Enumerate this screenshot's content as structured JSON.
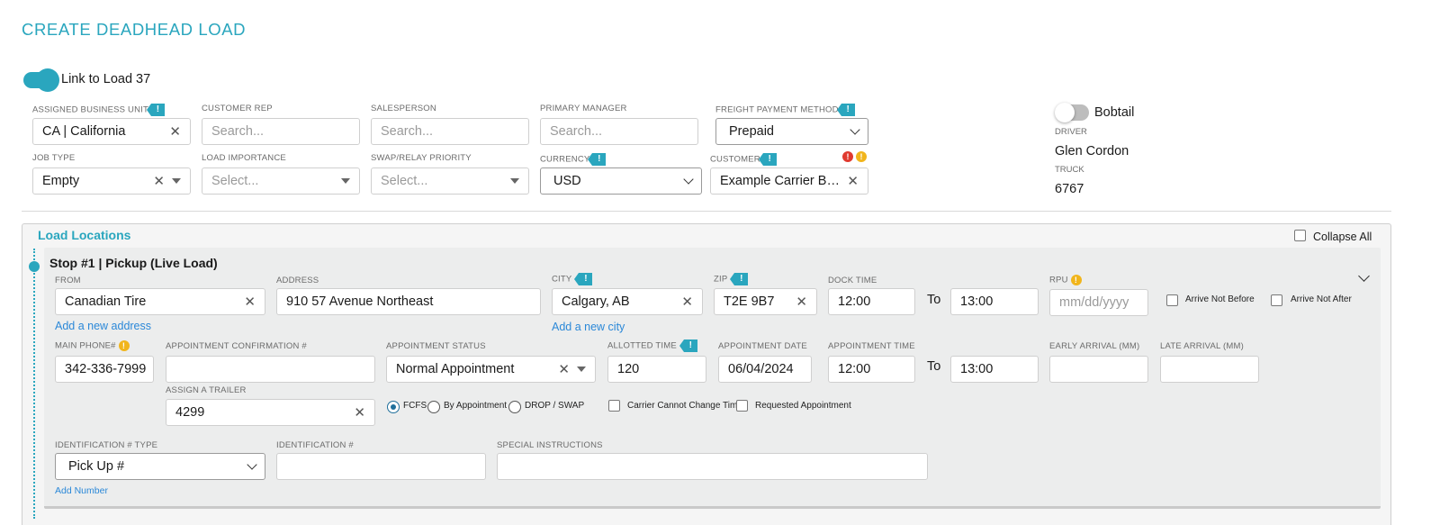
{
  "title": "CREATE DEADHEAD LOAD",
  "link_toggle": {
    "label": "Link to Load 37",
    "on": true
  },
  "header": {
    "business_unit": {
      "label": "ASSIGNED BUSINESS UNIT",
      "value": "CA | California"
    },
    "customer_rep": {
      "label": "CUSTOMER REP",
      "placeholder": "Search..."
    },
    "salesperson": {
      "label": "SALESPERSON",
      "placeholder": "Search..."
    },
    "primary_manager": {
      "label": "PRIMARY MANAGER",
      "placeholder": "Search..."
    },
    "freight_payment": {
      "label": "FREIGHT PAYMENT METHOD",
      "value": "Prepaid"
    },
    "job_type": {
      "label": "JOB TYPE",
      "value": "Empty"
    },
    "load_importance": {
      "label": "LOAD IMPORTANCE",
      "placeholder": "Select..."
    },
    "swap_priority": {
      "label": "SWAP/RELAY PRIORITY",
      "placeholder": "Select..."
    },
    "currency": {
      "label": "CURRENCY",
      "value": "USD"
    },
    "customer": {
      "label": "CUSTOMER",
      "value": "Example Carrier Broke..."
    }
  },
  "side": {
    "bobtail_label": "Bobtail",
    "bobtail_on": false,
    "driver_label": "DRIVER",
    "driver_value": "Glen Cordon",
    "truck_label": "TRUCK",
    "truck_value": "6767"
  },
  "locations": {
    "title": "Load Locations",
    "collapse_all": "Collapse All",
    "stop": {
      "title": "Stop #1 | Pickup (Live Load)",
      "from": {
        "label": "FROM",
        "value": "Canadian Tire"
      },
      "address": {
        "label": "ADDRESS",
        "value": "910 57 Avenue Northeast"
      },
      "city": {
        "label": "CITY",
        "value": "Calgary, AB"
      },
      "zip": {
        "label": "ZIP",
        "value": "T2E 9B7"
      },
      "dock_time": {
        "label": "DOCK TIME",
        "from": "12:00",
        "to": "13:00"
      },
      "to_word": "To",
      "rpu": {
        "label": "RPU",
        "placeholder": "mm/dd/yyyy"
      },
      "arrive_not_before": "Arrive Not Before",
      "arrive_not_after": "Arrive Not After",
      "add_address": "Add a new address",
      "add_city": "Add a new city",
      "main_phone": {
        "label": "MAIN PHONE#",
        "value": "342-336-7999"
      },
      "appt_confirmation": {
        "label": "APPOINTMENT CONFIRMATION #",
        "value": ""
      },
      "appt_status": {
        "label": "APPOINTMENT STATUS",
        "value": "Normal Appointment"
      },
      "allotted_time": {
        "label": "ALLOTTED TIME",
        "value": "120"
      },
      "appt_date": {
        "label": "APPOINTMENT DATE",
        "value": "06/04/2024"
      },
      "appt_time": {
        "label": "APPOINTMENT TIME",
        "from": "12:00",
        "to": "13:00"
      },
      "early_arrival": {
        "label": "EARLY ARRIVAL (MM)",
        "value": ""
      },
      "late_arrival": {
        "label": "LATE ARRIVAL (MM)",
        "value": ""
      },
      "assign_trailer": {
        "label": "ASSIGN A TRAILER",
        "value": "4299"
      },
      "radios": [
        "FCFS",
        "By Appointment",
        "DROP / SWAP"
      ],
      "carrier_cannot_change": "Carrier Cannot Change Time",
      "requested_appointment": "Requested Appointment",
      "id_type": {
        "label": "IDENTIFICATION # TYPE",
        "value": "Pick Up #"
      },
      "id_number": {
        "label": "IDENTIFICATION #",
        "value": ""
      },
      "special_instructions": {
        "label": "SPECIAL INSTRUCTIONS",
        "value": ""
      },
      "add_number": "Add Number"
    }
  },
  "colors": {
    "accent": "#2aa6be",
    "link": "#2b88d8",
    "warning": "#f1b51c",
    "error": "#e03a2f"
  }
}
